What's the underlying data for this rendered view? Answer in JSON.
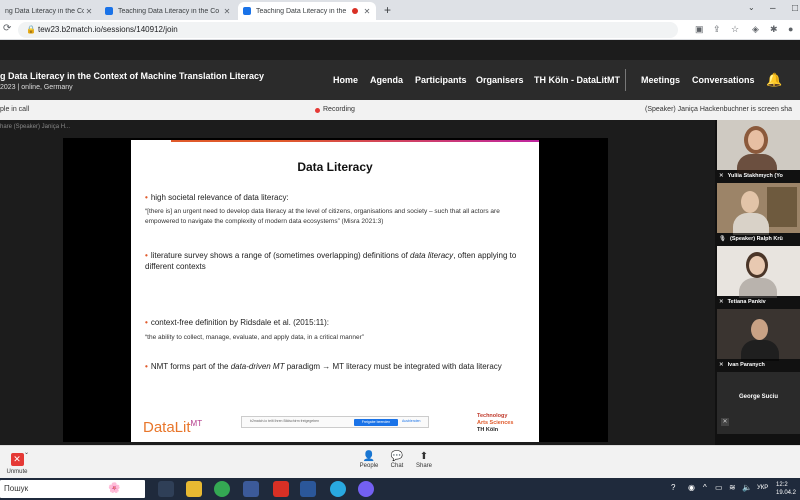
{
  "browser": {
    "tabs": [
      {
        "title": "ng Data Literacy in the Co"
      },
      {
        "title": "Teaching Data Literacy in the Co"
      },
      {
        "title": "Teaching Data Literacy in the"
      }
    ],
    "new_tab": "+",
    "url": "tew23.b2match.io/sessions/140912/join"
  },
  "site": {
    "event_title": "g Data Literacy in the Context of Machine Translation Literacy",
    "event_subtitle": "2023 | online, Germany",
    "nav": [
      "Home",
      "Agenda",
      "Participants",
      "Organisers",
      "TH Köln - DataLitMT",
      "Meetings",
      "Conversations"
    ]
  },
  "status": {
    "people_in_call": "ple in call",
    "recording": "Recording",
    "screen_share": "(Speaker) Janiça Hackenbuchner is screen sha"
  },
  "stage": {
    "share_label": "hare (Speaker) Janiça H..."
  },
  "slide": {
    "title": "Data Literacy",
    "bullet1": "high societal relevance of data literacy:",
    "quote1": "“[there is] an urgent need to develop data literacy at the level of citizens, organisations and society – such that all actors are empowered to navigate the complexity of modern data ecosystems” (Misra 2021:3)",
    "bullet2_pre": "literature survey shows a range of (sometimes overlapping) definitions of ",
    "bullet2_em": "data literacy",
    "bullet2_post": ", often applying to different contexts",
    "bullet3": "context-free definition by Ridsdale et al. (2015:11):",
    "quote3": "“the ability to collect, manage, evaluate, and apply data, in a critical manner”",
    "bullet4_pre": "NMT forms part of the ",
    "bullet4_em": "data-driven MT",
    "bullet4_post": " paradigm → MT literacy must be integrated with data literacy",
    "logo_data": "DataLit",
    "logo_mt": "MT",
    "share_notice": "b2match.io teilt Ihren Bildschirm freigegeben",
    "share_button": "Freigabe beenden",
    "hide_button": "Ausblenden",
    "th_line1": "Technology",
    "th_line2": "Arts Sciences",
    "th_line3": "TH Köln"
  },
  "participants": [
    {
      "name": "Yuliia Stakhmych (Yo"
    },
    {
      "name": "(Speaker) Ralph Krü"
    },
    {
      "name": "Tetiana Pankiv"
    },
    {
      "name": "Ivan Paranych"
    },
    {
      "name": "George Suciu"
    }
  ],
  "toolbar": {
    "unmute": "Unmute",
    "people": "People",
    "chat": "Chat",
    "share": "Share"
  },
  "taskbar": {
    "search": "Пошук",
    "lang": "УКР",
    "time": "12:2",
    "date": "19.04.2"
  }
}
